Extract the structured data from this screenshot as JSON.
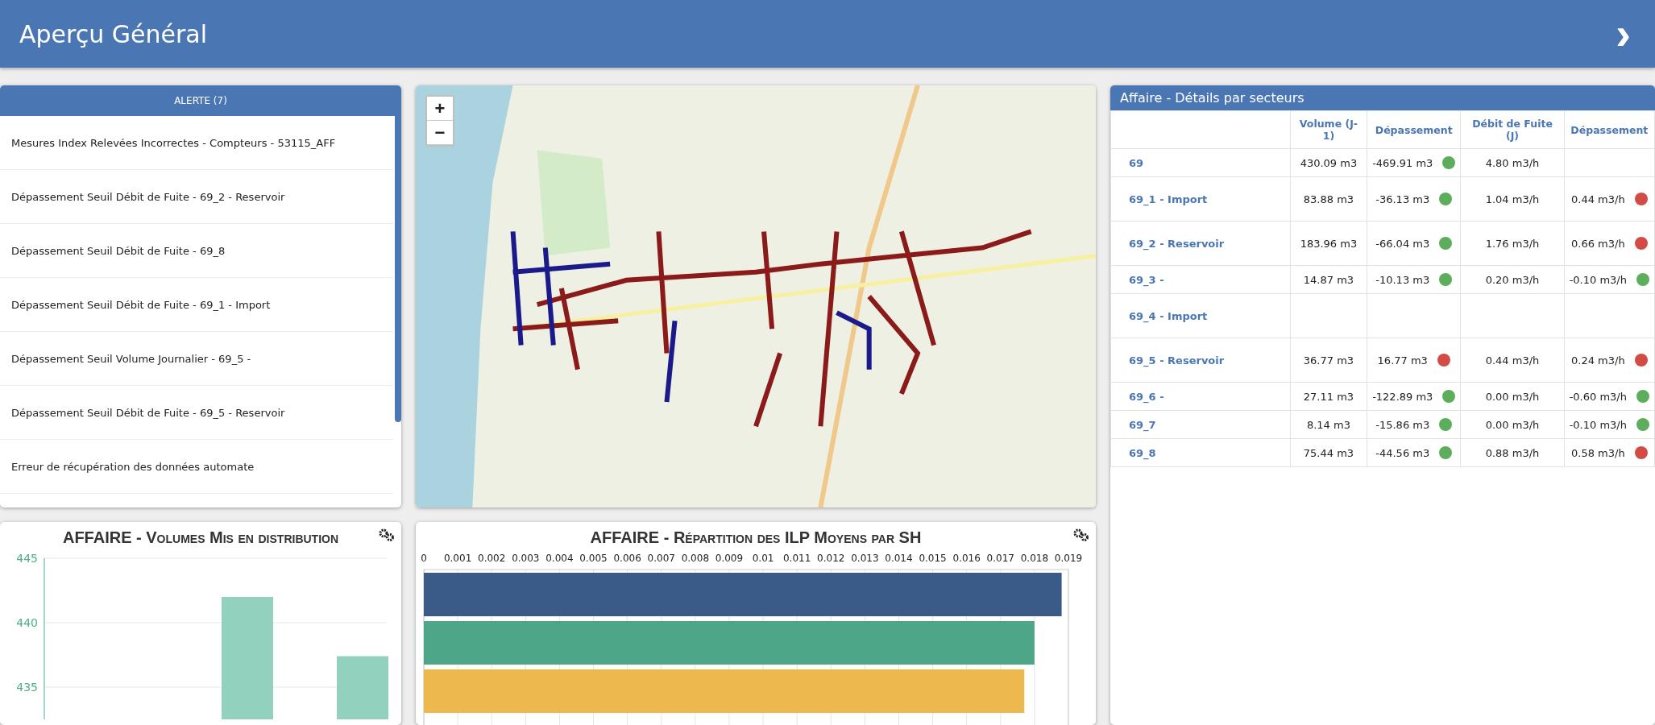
{
  "header": {
    "title": "Aperçu Général",
    "next": "›"
  },
  "alerts": {
    "title": "ALERTE (7)",
    "items": [
      {
        "text": "Mesures Index Relevées Incorrectes - Compteurs - 53115_AFF"
      },
      {
        "text": "Dépassement Seuil Débit de Fuite - 69_2 - Reservoir"
      },
      {
        "text": "Dépassement Seuil Débit de Fuite - 69_8"
      },
      {
        "text": "Dépassement Seuil Débit de Fuite - 69_1 - Import"
      },
      {
        "text": "Dépassement Seuil Volume Journalier - 69_5 -"
      },
      {
        "text": "Dépassement Seuil Débit de Fuite - 69_5 - Reservoir"
      },
      {
        "text": "Erreur de récupération des données automate"
      }
    ]
  },
  "map": {
    "zoom_in": "+",
    "zoom_out": "−"
  },
  "sectors": {
    "title": "Affaire - Détails par secteurs",
    "columns": [
      "Volume (J-1)",
      "Dépassement",
      "Débit de Fuite (J)",
      "Dépassement"
    ],
    "rows": [
      {
        "name": "69",
        "volume": "430.09 m3",
        "volume_excess": {
          "value": "-469.91 m3",
          "color": "#5cad5c"
        },
        "leak": "4.80 m3/h"
      },
      {
        "name": "69_1 - Import",
        "volume": "83.88 m3",
        "volume_excess": {
          "value": "-36.13 m3",
          "color": "#5cad5c"
        },
        "leak": "1.04 m3/h",
        "leak_excess": {
          "value": "0.44 m3/h",
          "color": "#d24b45"
        }
      },
      {
        "name": "69_2 - Reservoir",
        "volume": "183.96 m3",
        "volume_excess": {
          "value": "-66.04 m3",
          "color": "#5cad5c"
        },
        "leak": "1.76 m3/h",
        "leak_excess": {
          "value": "0.66 m3/h",
          "color": "#d24b45"
        }
      },
      {
        "name": "69_3 -",
        "volume": "14.87 m3",
        "volume_excess": {
          "value": "-10.13 m3",
          "color": "#5cad5c"
        },
        "leak": "0.20 m3/h",
        "leak_excess": {
          "value": "-0.10 m3/h",
          "color": "#5cad5c"
        }
      },
      {
        "name": "69_4 - Import"
      },
      {
        "name": "69_5 - Reservoir",
        "volume": "36.77 m3",
        "volume_excess": {
          "value": "16.77 m3",
          "color": "#d24b45"
        },
        "leak": "0.44 m3/h",
        "leak_excess": {
          "value": "0.24 m3/h",
          "color": "#d24b45"
        }
      },
      {
        "name": "69_6 -",
        "volume": "27.11 m3",
        "volume_excess": {
          "value": "-122.89 m3",
          "color": "#5cad5c"
        },
        "leak": "0.00 m3/h",
        "leak_excess": {
          "value": "-0.60 m3/h",
          "color": "#5cad5c"
        }
      },
      {
        "name": "69_7",
        "volume": "8.14 m3",
        "volume_excess": {
          "value": "-15.86 m3",
          "color": "#5cad5c"
        },
        "leak": "0.00 m3/h",
        "leak_excess": {
          "value": "-0.10 m3/h",
          "color": "#5cad5c"
        }
      },
      {
        "name": "69_8",
        "volume": "75.44 m3",
        "volume_excess": {
          "value": "-44.56 m3",
          "color": "#5cad5c"
        },
        "leak": "0.88 m3/h",
        "leak_excess": {
          "value": "0.58 m3/h",
          "color": "#d24b45"
        }
      }
    ]
  },
  "volumes_chart": {
    "title": "AFFAIRE - Volumes Mis en distribution",
    "chart_data": {
      "type": "bar",
      "values": [
        null,
        442,
        437.4
      ],
      "ylim": [
        432.5,
        445
      ],
      "yticks": [
        435,
        440,
        445
      ]
    }
  },
  "ilp_chart": {
    "title": "AFFAIRE - Répartition des ILP Moyens par SH",
    "chart_data": {
      "type": "bar",
      "orientation": "horizontal",
      "xlim": [
        0,
        0.019
      ],
      "xticks": [
        0,
        0.001,
        0.002,
        0.003,
        0.004,
        0.005,
        0.006,
        0.007,
        0.008,
        0.009,
        0.01,
        0.011,
        0.012,
        0.013,
        0.014,
        0.015,
        0.016,
        0.017,
        0.018,
        0.019
      ],
      "grid": true,
      "series": [
        {
          "color": "#3a5a87",
          "values": [
            0.0188
          ]
        },
        {
          "color": "#4da688",
          "values": [
            0.018
          ]
        },
        {
          "color": "#edb94f",
          "values": [
            0.0177
          ]
        }
      ]
    }
  }
}
